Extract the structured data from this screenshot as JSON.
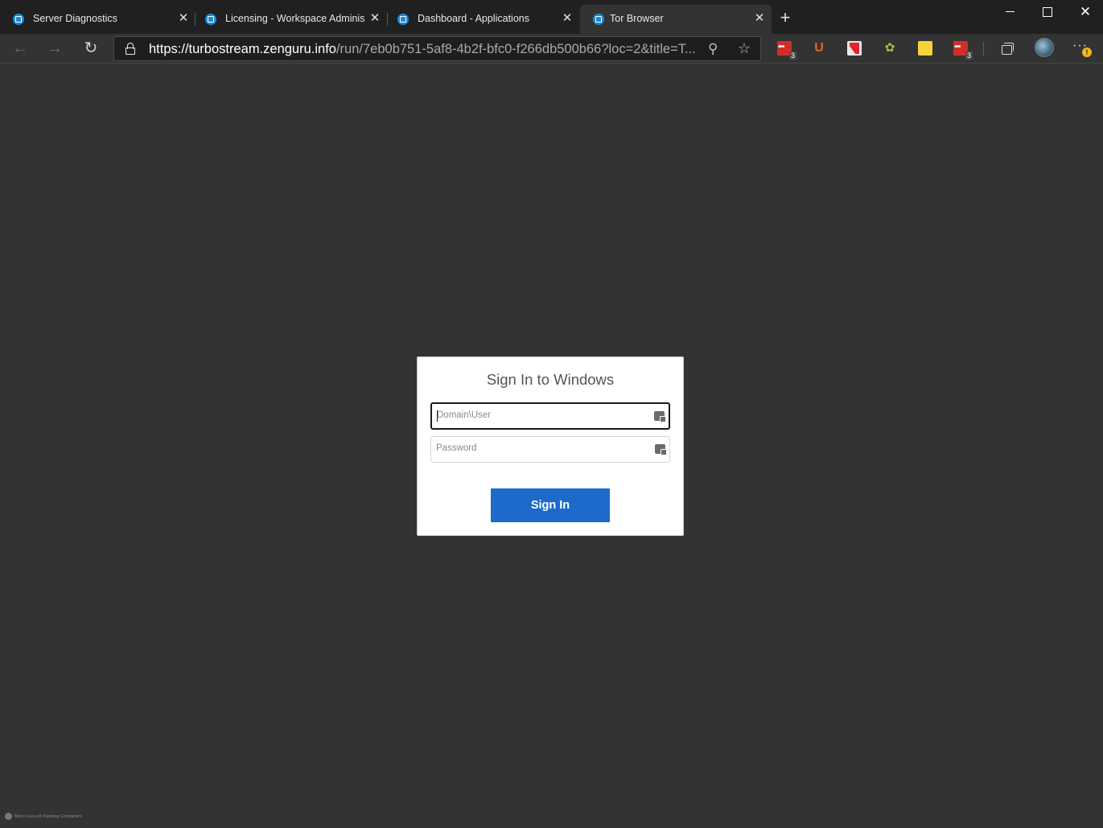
{
  "tabs": [
    {
      "title": "Server Diagnostics",
      "active": false
    },
    {
      "title": "Licensing - Workspace Administr",
      "active": false
    },
    {
      "title": "Dashboard - Applications",
      "active": false
    },
    {
      "title": "Tor Browser",
      "active": true
    }
  ],
  "address_bar": {
    "host": "https://turbostream.zenguru.info",
    "path": "/run/7eb0b751-5af8-4b2f-bfc0-f266db500b66?loc=2&title=T..."
  },
  "extensions": [
    {
      "name": "lastpass-icon",
      "badge": "3"
    },
    {
      "name": "ublock-icon",
      "badge": ""
    },
    {
      "name": "pdf-icon",
      "badge": ""
    },
    {
      "name": "android-icon",
      "badge": ""
    },
    {
      "name": "sticky-note-icon",
      "badge": ""
    },
    {
      "name": "lastpass-icon",
      "badge": "3"
    }
  ],
  "more_badge": "!",
  "signin": {
    "heading": "Sign In to Windows",
    "username_placeholder": "Domain\\User",
    "password_placeholder": "Password",
    "button_label": "Sign In"
  },
  "footer": {
    "text": "Micro Focus® Desktop Containers"
  },
  "colors": {
    "background": "#333333",
    "tabstrip": "#202020",
    "accent_button": "#1c6ac9"
  }
}
